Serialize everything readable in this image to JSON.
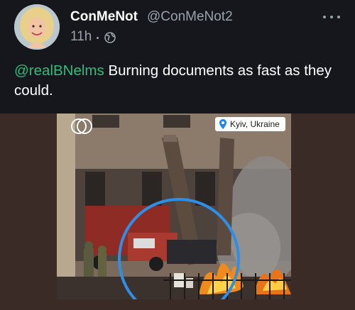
{
  "header": {
    "display_name": "ConMeNot",
    "handle": "@ConMeNot2",
    "time": "11h",
    "more_icon": "more-horizontal-icon",
    "privacy_icon": "globe-icon"
  },
  "tweet": {
    "mention": "@realBNelms",
    "text": " Burning documents as fast as they could."
  },
  "media": {
    "logo": "DW",
    "location": "Kyiv, Ukraine"
  },
  "colors": {
    "background": "#15171c",
    "mention": "#2fbb7d",
    "muted": "#9aa3ab",
    "ring": "#2f8fe6"
  }
}
